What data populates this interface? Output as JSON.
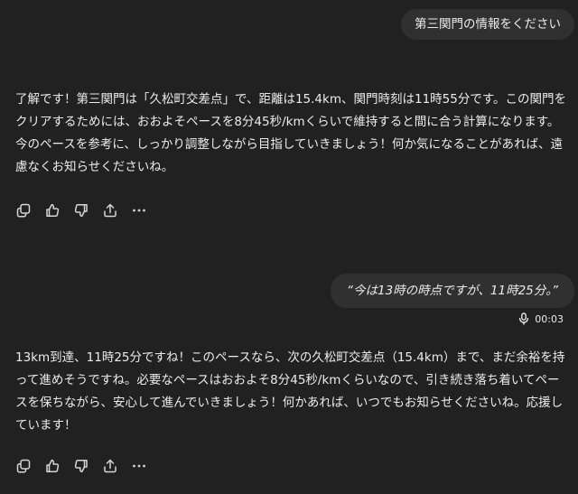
{
  "conversation": {
    "user_message_1": "第三関門の情報をください",
    "assistant_message_1": "了解です！第三関門は「久松町交差点」で、距離は15.4km、関門時刻は11時55分です。この関門をクリアするためには、おおよそペースを8分45秒/kmくらいで維持すると間に合う計算になります。今のペースを参考に、しっかり調整しながら目指していきましょう！何か気になることがあれば、遠慮なくお知らせくださいね。",
    "user_message_2": "“今は13時の時点ですが、11時25分。”",
    "voice_duration": "00:03",
    "assistant_message_2": "13km到達、11時25分ですね！このペースなら、次の久松町交差点（15.4km）まで、まだ余裕を持って進めそうですね。必要なペースはおおよそ8分45秒/kmくらいなので、引き続き落ち着いてペースを保ちながら、安心して進んでいきましょう！何かあれば、いつでもお知らせくださいね。応援しています！"
  },
  "action_icons": [
    "copy-icon",
    "thumbs-up-icon",
    "thumbs-down-icon",
    "share-icon",
    "more-icon"
  ],
  "theme": {
    "background": "#212121",
    "bubble": "#303030",
    "text": "#ececec",
    "icon": "#d6d6d6"
  }
}
